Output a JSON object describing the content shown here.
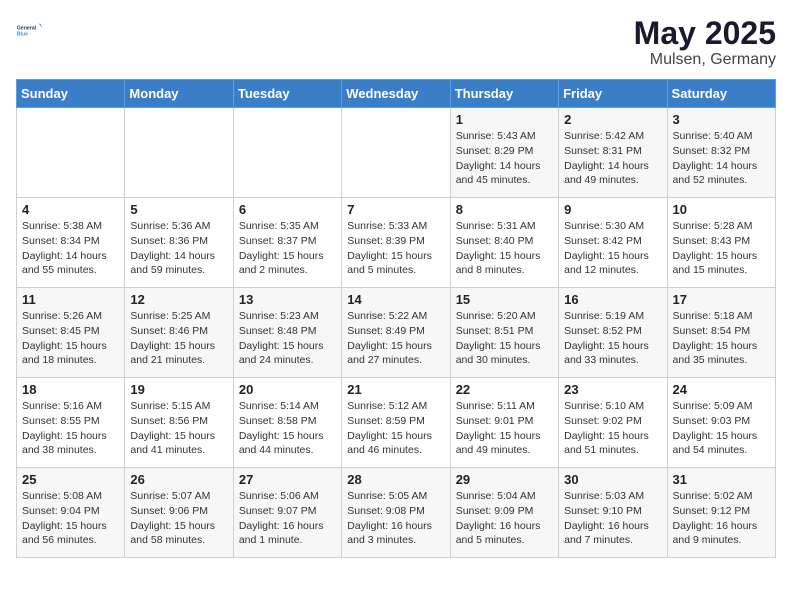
{
  "header": {
    "logo_line1": "General",
    "logo_line2": "Blue",
    "month": "May 2025",
    "location": "Mulsen, Germany"
  },
  "weekdays": [
    "Sunday",
    "Monday",
    "Tuesday",
    "Wednesday",
    "Thursday",
    "Friday",
    "Saturday"
  ],
  "weeks": [
    [
      {
        "day": "",
        "info": ""
      },
      {
        "day": "",
        "info": ""
      },
      {
        "day": "",
        "info": ""
      },
      {
        "day": "",
        "info": ""
      },
      {
        "day": "1",
        "info": "Sunrise: 5:43 AM\nSunset: 8:29 PM\nDaylight: 14 hours\nand 45 minutes."
      },
      {
        "day": "2",
        "info": "Sunrise: 5:42 AM\nSunset: 8:31 PM\nDaylight: 14 hours\nand 49 minutes."
      },
      {
        "day": "3",
        "info": "Sunrise: 5:40 AM\nSunset: 8:32 PM\nDaylight: 14 hours\nand 52 minutes."
      }
    ],
    [
      {
        "day": "4",
        "info": "Sunrise: 5:38 AM\nSunset: 8:34 PM\nDaylight: 14 hours\nand 55 minutes."
      },
      {
        "day": "5",
        "info": "Sunrise: 5:36 AM\nSunset: 8:36 PM\nDaylight: 14 hours\nand 59 minutes."
      },
      {
        "day": "6",
        "info": "Sunrise: 5:35 AM\nSunset: 8:37 PM\nDaylight: 15 hours\nand 2 minutes."
      },
      {
        "day": "7",
        "info": "Sunrise: 5:33 AM\nSunset: 8:39 PM\nDaylight: 15 hours\nand 5 minutes."
      },
      {
        "day": "8",
        "info": "Sunrise: 5:31 AM\nSunset: 8:40 PM\nDaylight: 15 hours\nand 8 minutes."
      },
      {
        "day": "9",
        "info": "Sunrise: 5:30 AM\nSunset: 8:42 PM\nDaylight: 15 hours\nand 12 minutes."
      },
      {
        "day": "10",
        "info": "Sunrise: 5:28 AM\nSunset: 8:43 PM\nDaylight: 15 hours\nand 15 minutes."
      }
    ],
    [
      {
        "day": "11",
        "info": "Sunrise: 5:26 AM\nSunset: 8:45 PM\nDaylight: 15 hours\nand 18 minutes."
      },
      {
        "day": "12",
        "info": "Sunrise: 5:25 AM\nSunset: 8:46 PM\nDaylight: 15 hours\nand 21 minutes."
      },
      {
        "day": "13",
        "info": "Sunrise: 5:23 AM\nSunset: 8:48 PM\nDaylight: 15 hours\nand 24 minutes."
      },
      {
        "day": "14",
        "info": "Sunrise: 5:22 AM\nSunset: 8:49 PM\nDaylight: 15 hours\nand 27 minutes."
      },
      {
        "day": "15",
        "info": "Sunrise: 5:20 AM\nSunset: 8:51 PM\nDaylight: 15 hours\nand 30 minutes."
      },
      {
        "day": "16",
        "info": "Sunrise: 5:19 AM\nSunset: 8:52 PM\nDaylight: 15 hours\nand 33 minutes."
      },
      {
        "day": "17",
        "info": "Sunrise: 5:18 AM\nSunset: 8:54 PM\nDaylight: 15 hours\nand 35 minutes."
      }
    ],
    [
      {
        "day": "18",
        "info": "Sunrise: 5:16 AM\nSunset: 8:55 PM\nDaylight: 15 hours\nand 38 minutes."
      },
      {
        "day": "19",
        "info": "Sunrise: 5:15 AM\nSunset: 8:56 PM\nDaylight: 15 hours\nand 41 minutes."
      },
      {
        "day": "20",
        "info": "Sunrise: 5:14 AM\nSunset: 8:58 PM\nDaylight: 15 hours\nand 44 minutes."
      },
      {
        "day": "21",
        "info": "Sunrise: 5:12 AM\nSunset: 8:59 PM\nDaylight: 15 hours\nand 46 minutes."
      },
      {
        "day": "22",
        "info": "Sunrise: 5:11 AM\nSunset: 9:01 PM\nDaylight: 15 hours\nand 49 minutes."
      },
      {
        "day": "23",
        "info": "Sunrise: 5:10 AM\nSunset: 9:02 PM\nDaylight: 15 hours\nand 51 minutes."
      },
      {
        "day": "24",
        "info": "Sunrise: 5:09 AM\nSunset: 9:03 PM\nDaylight: 15 hours\nand 54 minutes."
      }
    ],
    [
      {
        "day": "25",
        "info": "Sunrise: 5:08 AM\nSunset: 9:04 PM\nDaylight: 15 hours\nand 56 minutes."
      },
      {
        "day": "26",
        "info": "Sunrise: 5:07 AM\nSunset: 9:06 PM\nDaylight: 15 hours\nand 58 minutes."
      },
      {
        "day": "27",
        "info": "Sunrise: 5:06 AM\nSunset: 9:07 PM\nDaylight: 16 hours\nand 1 minute."
      },
      {
        "day": "28",
        "info": "Sunrise: 5:05 AM\nSunset: 9:08 PM\nDaylight: 16 hours\nand 3 minutes."
      },
      {
        "day": "29",
        "info": "Sunrise: 5:04 AM\nSunset: 9:09 PM\nDaylight: 16 hours\nand 5 minutes."
      },
      {
        "day": "30",
        "info": "Sunrise: 5:03 AM\nSunset: 9:10 PM\nDaylight: 16 hours\nand 7 minutes."
      },
      {
        "day": "31",
        "info": "Sunrise: 5:02 AM\nSunset: 9:12 PM\nDaylight: 16 hours\nand 9 minutes."
      }
    ]
  ]
}
